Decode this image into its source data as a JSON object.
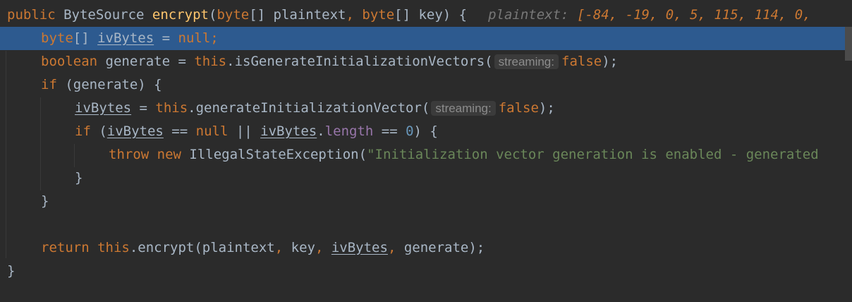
{
  "editor": {
    "lines": [
      {
        "tokens": [
          {
            "t": "public ",
            "c": "kw"
          },
          {
            "t": "ByteSource ",
            "c": ""
          },
          {
            "t": "encrypt",
            "c": "fn"
          },
          {
            "t": "(",
            "c": ""
          },
          {
            "t": "byte",
            "c": "kw"
          },
          {
            "t": "[] plaintext",
            "c": ""
          },
          {
            "t": ", ",
            "c": "kw"
          },
          {
            "t": "byte",
            "c": "kw"
          },
          {
            "t": "[] key) {",
            "c": ""
          }
        ],
        "inline_debug": {
          "name": "plaintext:",
          "value": "[-84, -19, 0, 5, 115, 114, 0,"
        }
      },
      {
        "current": true,
        "tokens": [
          {
            "t": "byte",
            "c": "kw"
          },
          {
            "t": "[] ",
            "c": ""
          },
          {
            "t": "ivBytes",
            "c": "var-u"
          },
          {
            "t": " = ",
            "c": ""
          },
          {
            "t": "null",
            "c": "kw"
          },
          {
            "t": ";",
            "c": "kw"
          }
        ]
      },
      {
        "tokens": [
          {
            "t": "boolean ",
            "c": "kw"
          },
          {
            "t": "generate = ",
            "c": ""
          },
          {
            "t": "this",
            "c": "kw"
          },
          {
            "t": ".isGenerateInitializationVectors(",
            "c": ""
          },
          {
            "hint": "streaming:"
          },
          {
            "t": "false",
            "c": "kw"
          },
          {
            "t": ");",
            "c": ""
          }
        ]
      },
      {
        "tokens": [
          {
            "t": "if ",
            "c": "kw"
          },
          {
            "t": "(generate) {",
            "c": ""
          }
        ]
      },
      {
        "tokens": [
          {
            "t": "ivBytes",
            "c": "var-u"
          },
          {
            "t": " = ",
            "c": ""
          },
          {
            "t": "this",
            "c": "kw"
          },
          {
            "t": ".generateInitializationVector(",
            "c": ""
          },
          {
            "hint": "streaming:"
          },
          {
            "t": "false",
            "c": "kw"
          },
          {
            "t": ");",
            "c": ""
          }
        ]
      },
      {
        "tokens": [
          {
            "t": "if ",
            "c": "kw"
          },
          {
            "t": "(",
            "c": ""
          },
          {
            "t": "ivBytes",
            "c": "var-u"
          },
          {
            "t": " == ",
            "c": ""
          },
          {
            "t": "null",
            "c": "kw"
          },
          {
            "t": " || ",
            "c": ""
          },
          {
            "t": "ivBytes",
            "c": "var-u"
          },
          {
            "t": ".",
            "c": ""
          },
          {
            "t": "length",
            "c": "field"
          },
          {
            "t": " == ",
            "c": ""
          },
          {
            "t": "0",
            "c": "num"
          },
          {
            "t": ") {",
            "c": ""
          }
        ]
      },
      {
        "tokens": [
          {
            "t": "throw ",
            "c": "kw"
          },
          {
            "t": "new ",
            "c": "kw"
          },
          {
            "t": "IllegalStateException(",
            "c": ""
          },
          {
            "t": "\"Initialization vector generation is enabled - generated",
            "c": "str"
          }
        ]
      },
      {
        "tokens": [
          {
            "t": "}",
            "c": ""
          }
        ]
      },
      {
        "tokens": [
          {
            "t": "}",
            "c": ""
          }
        ]
      },
      {
        "tokens": []
      },
      {
        "tokens": [
          {
            "t": "return ",
            "c": "kw"
          },
          {
            "t": "this",
            "c": "kw"
          },
          {
            "t": ".encrypt(plaintext",
            "c": ""
          },
          {
            "t": ", ",
            "c": "kw"
          },
          {
            "t": "key",
            "c": ""
          },
          {
            "t": ", ",
            "c": "kw"
          },
          {
            "t": "ivBytes",
            "c": "var-u"
          },
          {
            "t": ", ",
            "c": "kw"
          },
          {
            "t": "generate);",
            "c": ""
          }
        ]
      },
      {
        "tokens": [
          {
            "t": "}",
            "c": ""
          }
        ]
      }
    ]
  }
}
